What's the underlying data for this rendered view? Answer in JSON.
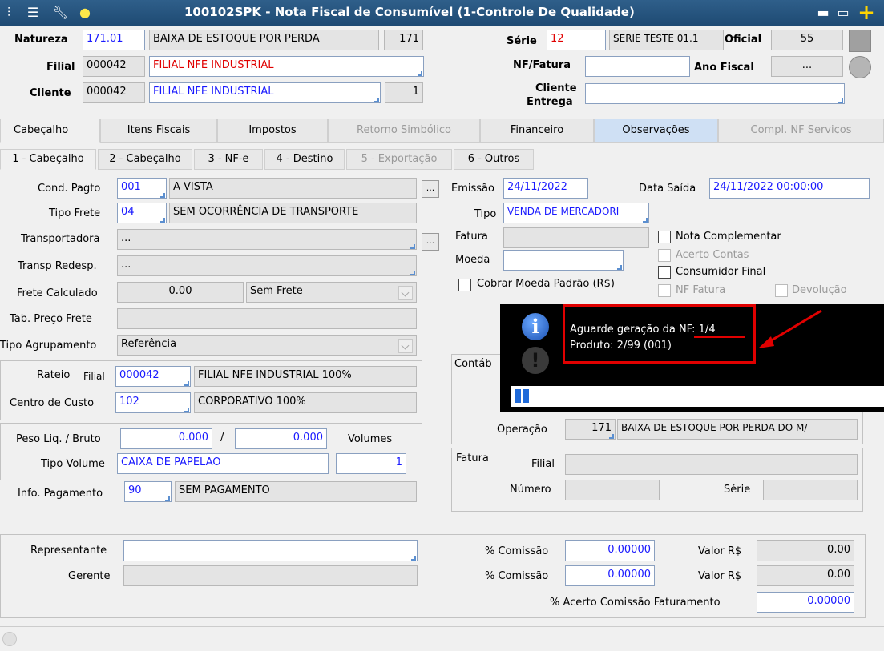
{
  "window": {
    "title": "100102SPK - Nota Fiscal de Consumível (1-Controle De Qualidade)"
  },
  "header": {
    "natureza_label": "Natureza",
    "natureza_code": "171.01",
    "natureza_desc": "BAIXA DE ESTOQUE POR PERDA",
    "natureza_num": "171",
    "filial_label": "Filial",
    "filial_code": "000042",
    "filial_desc": "FILIAL NFE INDUSTRIAL",
    "cliente_label": "Cliente",
    "cliente_code": "000042",
    "cliente_desc": "FILIAL NFE INDUSTRIAL",
    "cliente_num": "1",
    "serie_label": "Série",
    "serie_code": "12",
    "serie_desc": "SERIE TESTE 01.1",
    "oficial_label": "Oficial",
    "oficial_value": "55",
    "nf_fatura_label": "NF/Fatura",
    "nf_fatura_value": "",
    "ano_fiscal_label": "Ano Fiscal",
    "ano_fiscal_value": "...",
    "cliente_entrega_label1": "Cliente",
    "cliente_entrega_label2": "Entrega",
    "cliente_entrega_value": ""
  },
  "tabs": [
    {
      "label": "Cabeçalho"
    },
    {
      "label": "Itens Fiscais"
    },
    {
      "label": "Impostos"
    },
    {
      "label": "Retorno Simbólico"
    },
    {
      "label": "Financeiro"
    },
    {
      "label": "Observações"
    },
    {
      "label": "Compl. NF Serviços"
    }
  ],
  "subtabs": [
    {
      "label": "1 - Cabeçalho"
    },
    {
      "label": "2 - Cabeçalho"
    },
    {
      "label": "3 - NF-e"
    },
    {
      "label": "4 - Destino"
    },
    {
      "label": "5 - Exportação"
    },
    {
      "label": "6 - Outros"
    }
  ],
  "form": {
    "cond_pagto_label": "Cond. Pagto",
    "cond_pagto_code": "001",
    "cond_pagto_desc": "A VISTA",
    "tipo_frete_label": "Tipo Frete",
    "tipo_frete_code": "04",
    "tipo_frete_desc": "SEM OCORRÊNCIA DE TRANSPORTE",
    "transportadora_label": "Transportadora",
    "transportadora_value": "...",
    "transp_redesp_label": "Transp Redesp.",
    "transp_redesp_value": "...",
    "frete_calculado_label": "Frete Calculado",
    "frete_calculado_value": "0.00",
    "frete_tipo": "Sem Frete",
    "tab_preco_frete_label": "Tab. Preço Frete",
    "tipo_agrupamento_label": "Tipo Agrupamento",
    "tipo_agrupamento_value": "Referência",
    "rateio_label": "Rateio",
    "rateio_filial_label": "Filial",
    "rateio_filial_code": "000042",
    "rateio_filial_desc": "FILIAL NFE INDUSTRIAL 100%",
    "centro_custo_label": "Centro de Custo",
    "centro_custo_code": "102",
    "centro_custo_desc": "CORPORATIVO 100%",
    "peso_label": "Peso Liq. / Bruto",
    "peso_liq": "0.000",
    "peso_sep": "/",
    "peso_bruto": "0.000",
    "volumes_label": "Volumes",
    "tipo_volume_label": "Tipo Volume",
    "tipo_volume_value": "CAIXA DE PAPELAO",
    "volumes_value": "1",
    "info_pagamento_label": "Info. Pagamento",
    "info_pagamento_code": "90",
    "info_pagamento_desc": "SEM PAGAMENTO",
    "emissao_label": "Emissão",
    "emissao_value": "24/11/2022",
    "data_saida_label": "Data Saída",
    "data_saida_value": "24/11/2022 00:00:00",
    "tipo_label": "Tipo",
    "tipo_value": "VENDA DE MERCADORI",
    "fatura_label": "Fatura",
    "moeda_label": "Moeda",
    "cobrar_moeda_label": "Cobrar Moeda Padrão (R$)",
    "nota_complementar_label": "Nota Complementar",
    "acerto_contas_label": "Acerto Contas",
    "consumidor_final_label": "Consumidor Final",
    "nf_fatura_chk_label": "NF Fatura",
    "devolucao_label": "Devolução",
    "contab_label": "Contáb",
    "operacao_label": "Operação",
    "operacao_code": "171",
    "operacao_desc": "BAIXA DE ESTOQUE POR PERDA DO M/",
    "fatura_group_label": "Fatura",
    "fatura_filial_label": "Filial",
    "fatura_numero_label": "Número",
    "fatura_serie_label": "Série",
    "representante_label": "Representante",
    "gerente_label": "Gerente",
    "comissao1_label": "% Comissão",
    "comissao1_value": "0.00000",
    "valor1_label": "Valor R$",
    "valor1_value": "0.00",
    "comissao2_label": "% Comissão",
    "comissao2_value": "0.00000",
    "valor2_label": "Valor R$",
    "valor2_value": "0.00",
    "acerto_comissao_label": "% Acerto Comissão Faturamento",
    "acerto_comissao_value": "0.00000"
  },
  "popup": {
    "line1": "Aguarde geração da NF: 1/4",
    "line2": "Produto: 2/99 (001)",
    "progress": 0.03
  },
  "colors": {
    "title_bar": "#1e4a73",
    "highlight": "#e00000",
    "link_blue": "#1a1aff"
  }
}
